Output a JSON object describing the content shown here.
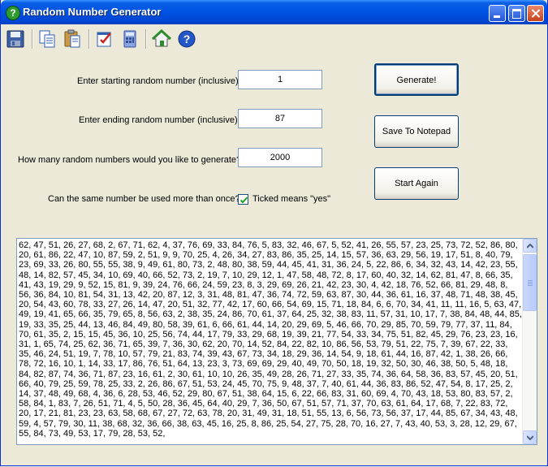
{
  "window": {
    "title": "Random Number Generator"
  },
  "toolbar": {
    "items": [
      "save-icon",
      "copy-icon",
      "paste-icon",
      "checklist-icon",
      "calculator-icon",
      "home-icon",
      "help-icon"
    ],
    "help_glyph": "?"
  },
  "form": {
    "start_label": "Enter starting random number (inclusive):",
    "start_value": "1",
    "end_label": "Enter ending random number (inclusive):",
    "end_value": "87",
    "count_label": "How many random numbers would you like to generate?",
    "count_value": "2000",
    "repeat_label": "Can the same number be used more than once?",
    "repeat_checked": true,
    "repeat_hint": "Ticked means \"yes\""
  },
  "buttons": {
    "generate": "Generate!",
    "save": "Save To Notepad",
    "restart": "Start Again"
  },
  "output": {
    "text": "62, 47, 51, 26, 27, 68, 2, 67, 71, 62, 4, 37, 76, 69, 33, 84, 76, 5, 83, 32, 46, 67, 5, 52, 41, 26, 55, 57, 23, 25, 73, 72, 52, 86, 80, 20, 61, 86, 22, 47, 10, 87, 59, 2, 51, 9, 9, 70, 25, 4, 26, 34, 27, 83, 86, 35, 25, 14, 15, 57, 36, 63, 29, 56, 19, 17, 51, 8, 40, 79, 23, 69, 33, 26, 80, 55, 55, 38, 9, 49, 61, 80, 73, 2, 48, 80, 38, 59, 44, 45, 41, 31, 36, 24, 5, 22, 86, 6, 34, 32, 43, 14, 42, 23, 55, 48, 14, 82, 57, 45, 34, 10, 69, 40, 66, 52, 73, 2, 19, 7, 10, 29, 12, 1, 47, 58, 48, 72, 8, 17, 60, 40, 32, 14, 62, 81, 47, 8, 66, 35, 41, 43, 19, 29, 9, 52, 15, 81, 9, 39, 24, 76, 66, 24, 59, 23, 8, 3, 29, 69, 26, 21, 42, 23, 30, 4, 42, 18, 76, 52, 66, 81, 29, 48, 8, 56, 36, 84, 10, 81, 54, 31, 13, 42, 20, 87, 12, 3, 31, 48, 81, 47, 36, 74, 72, 59, 63, 87, 30, 44, 36, 61, 16, 37, 48, 71, 48, 38, 45, 20, 54, 43, 60, 78, 33, 27, 26, 14, 47, 20, 51, 32, 77, 42, 17, 60, 66, 54, 69, 15, 71, 18, 84, 6, 6, 70, 34, 41, 11, 11, 16, 5, 63, 47, 49, 19, 41, 65, 66, 35, 79, 65, 8, 56, 63, 2, 38, 35, 24, 86, 70, 61, 37, 64, 25, 32, 38, 83, 11, 57, 31, 10, 17, 7, 38, 84, 48, 44, 85, 19, 33, 35, 25, 44, 13, 46, 84, 49, 80, 58, 39, 61, 6, 66, 61, 44, 14, 20, 29, 69, 5, 46, 66, 70, 29, 85, 70, 59, 79, 77, 37, 11, 84, 70, 61, 35, 2, 15, 15, 45, 36, 10, 25, 56, 74, 44, 17, 79, 33, 29, 68, 19, 39, 21, 77, 54, 33, 34, 75, 51, 82, 45, 29, 76, 23, 23, 16, 31, 1, 65, 74, 25, 62, 36, 71, 65, 39, 7, 36, 30, 62, 20, 70, 14, 52, 84, 22, 82, 10, 86, 56, 53, 79, 51, 22, 75, 7, 39, 67, 22, 33, 35, 46, 24, 51, 19, 7, 78, 10, 57, 79, 21, 83, 74, 39, 43, 67, 73, 34, 18, 29, 36, 14, 54, 9, 18, 61, 44, 16, 87, 42, 1, 38, 26, 66, 78, 72, 16, 10, 1, 14, 33, 17, 86, 76, 51, 64, 13, 23, 3, 73, 69, 69, 29, 40, 49, 70, 50, 18, 19, 32, 50, 30, 46, 38, 50, 5, 48, 18, 84, 82, 87, 74, 36, 71, 87, 23, 16, 61, 2, 30, 61, 10, 10, 26, 35, 49, 28, 26, 71, 27, 33, 35, 74, 36, 64, 58, 36, 83, 57, 45, 20, 51, 66, 40, 79, 25, 59, 78, 25, 33, 2, 26, 86, 67, 51, 53, 24, 45, 70, 75, 9, 48, 37, 7, 40, 61, 44, 36, 83, 86, 52, 47, 54, 8, 17, 25, 2, 14, 37, 48, 49, 68, 4, 36, 6, 28, 53, 46, 52, 29, 80, 67, 51, 38, 64, 15, 6, 22, 66, 83, 31, 60, 69, 4, 70, 43, 18, 53, 80, 83, 57, 2, 58, 84, 1, 83, 7, 26, 51, 71, 4, 5, 50, 28, 36, 45, 64, 40, 29, 7, 36, 50, 67, 51, 57, 71, 37, 70, 63, 61, 64, 17, 68, 7, 22, 83, 72, 20, 17, 21, 81, 23, 23, 63, 58, 68, 67, 27, 72, 63, 78, 20, 31, 49, 31, 18, 51, 55, 13, 6, 56, 73, 56, 37, 17, 44, 85, 67, 34, 43, 48, 59, 4, 57, 79, 30, 11, 38, 68, 32, 36, 66, 38, 63, 45, 16, 25, 8, 86, 25, 54, 27, 75, 28, 70, 16, 27, 7, 43, 40, 53, 3, 28, 12, 29, 67, 55, 84, 73, 49, 53, 17, 79, 28, 53, 52,"
  }
}
